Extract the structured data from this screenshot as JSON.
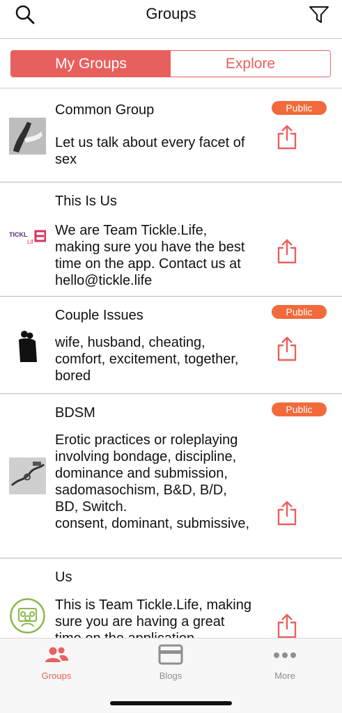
{
  "header": {
    "title": "Groups",
    "search_icon": "search-icon",
    "filter_icon": "filter-icon"
  },
  "segments": {
    "my_groups": "My Groups",
    "explore": "Explore",
    "active": "my_groups"
  },
  "groups": [
    {
      "name": "Common Group",
      "description": "Let us talk about every facet of sex",
      "badge": "Public"
    },
    {
      "name": "This Is Us",
      "description": "We are Team Tickle.Life, making sure you have the best time on the app. Contact us at hello@tickle.life",
      "badge": ""
    },
    {
      "name": "Couple Issues",
      "description": "wife, husband, cheating, comfort, excitement, together, bored",
      "badge": "Public"
    },
    {
      "name": "BDSM",
      "description": "Erotic practices or roleplaying involving bondage, discipline, dominance and submission, sadomasochism, B&D, B/D, BD, Switch.\nconsent, dominant, submissive,",
      "badge": "Public"
    },
    {
      "name": "Us",
      "description": "This is Team Tickle.Life, making sure you are having a great time on the application",
      "badge": ""
    }
  ],
  "tabbar": {
    "groups": "Groups",
    "blogs": "Blogs",
    "more": "More",
    "active": "groups"
  },
  "colors": {
    "accent": "#e8605e",
    "badge": "#f26a3b",
    "tab_inactive": "#8e8e93"
  }
}
